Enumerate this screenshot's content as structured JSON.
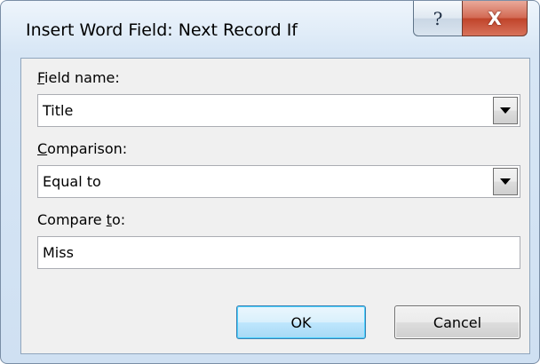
{
  "window": {
    "title": "Insert Word Field: Next Record If",
    "help_glyph": "?",
    "close_glyph": "X"
  },
  "form": {
    "field_name": {
      "label_accel": "F",
      "label_rest": "ield name:",
      "value": "Title"
    },
    "comparison": {
      "label_accel": "C",
      "label_rest": "omparison:",
      "value": "Equal to"
    },
    "compare_to": {
      "label_pre": "Compare ",
      "label_accel": "t",
      "label_rest": "o:",
      "value": "Miss"
    }
  },
  "buttons": {
    "ok_label": "OK",
    "cancel_label": "Cancel"
  },
  "icons": {
    "help": "help-icon",
    "close": "close-icon",
    "dropdown": "chevron-down-icon"
  }
}
